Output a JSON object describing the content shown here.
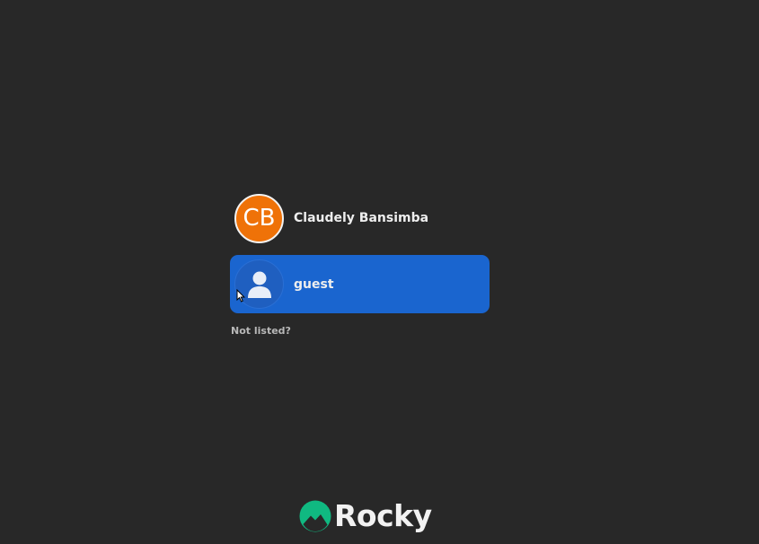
{
  "users": [
    {
      "display_name": "Claudely Bansimba",
      "initials": "CB",
      "avatar_color": "#ef7208",
      "selected": false
    },
    {
      "display_name": "guest",
      "avatar_icon": "person-icon",
      "selected": true,
      "highlight_color": "#1a65cf"
    }
  ],
  "not_listed_label": "Not listed?",
  "brand": {
    "name": "Rocky",
    "logo_icon": "rocky-logo-icon",
    "logo_color": "#10b981"
  },
  "background_color": "#282828"
}
